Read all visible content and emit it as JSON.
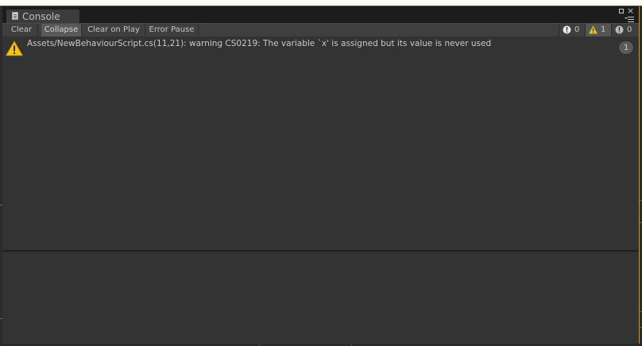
{
  "window": {
    "tab_label": "Console"
  },
  "toolbar": {
    "buttons": [
      {
        "label": "Clear",
        "active": false
      },
      {
        "label": "Collapse",
        "active": true
      },
      {
        "label": "Clear on Play",
        "active": false
      },
      {
        "label": "Error Pause",
        "active": false
      }
    ],
    "counters": {
      "info": {
        "count": "0",
        "icon": "info-icon"
      },
      "warning": {
        "count": "1",
        "icon": "warning-icon"
      },
      "error": {
        "count": "0",
        "icon": "error-icon"
      }
    }
  },
  "log": {
    "entries": [
      {
        "type": "warning",
        "icon": "warning-icon",
        "message": "Assets/NewBehaviourScript.cs(11,21): warning CS0219: The variable `x' is assigned but its value is never used",
        "collapse_count": "1"
      }
    ]
  },
  "colors": {
    "warning_yellow": "#f0c419",
    "panel_bg": "#333333",
    "toolbar_bg": "#3f3f3f",
    "focus_border": "#b99a3c"
  }
}
